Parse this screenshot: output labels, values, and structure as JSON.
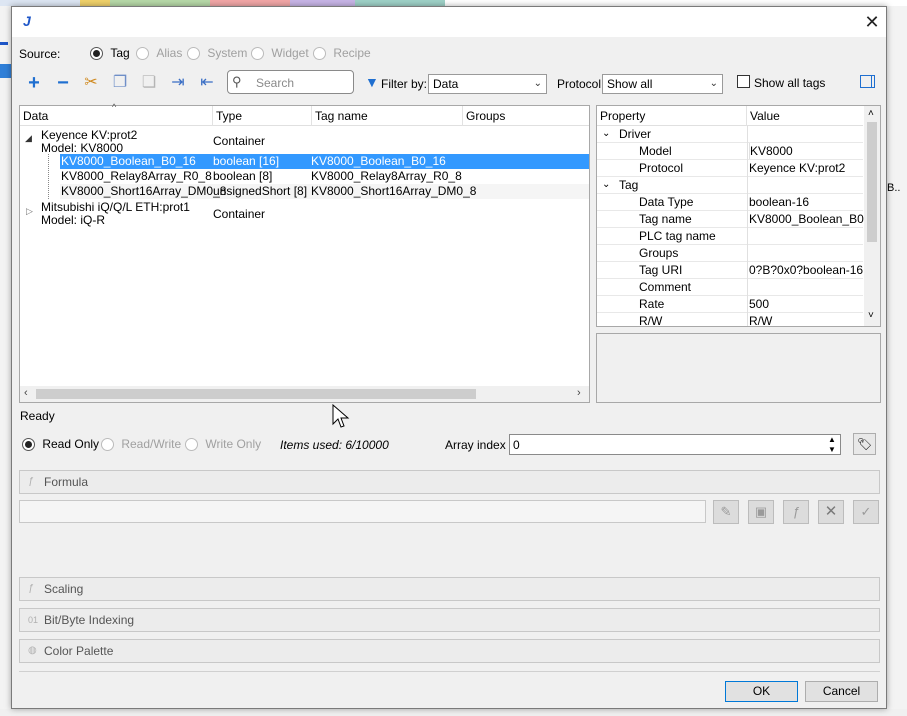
{
  "dialog": {
    "app_icon": "J",
    "close_glyph": "✕",
    "source": {
      "label": "Source:",
      "options": [
        "Tag",
        "Alias",
        "System",
        "Widget",
        "Recipe"
      ],
      "selected": "Tag"
    },
    "toolbar": {
      "search_placeholder": "Search",
      "filter_label": "Filter by:",
      "filter_value": "Data",
      "protocol_label": "Protocol:",
      "protocol_value": "Show all",
      "show_all_tags": "Show all tags"
    },
    "tree": {
      "columns": [
        "Data",
        "Type",
        "Tag name",
        "Groups"
      ],
      "groups": [
        {
          "line1": "Keyence KV:prot2",
          "line2": "Model: KV8000",
          "type": "Container",
          "expanded": true,
          "children": [
            {
              "data": "KV8000_Boolean_B0_16",
              "type": "boolean [16]",
              "tag": "KV8000_Boolean_B0_16",
              "selected": true
            },
            {
              "data": "KV8000_Relay8Array_R0_8",
              "type": "boolean [8]",
              "tag": "KV8000_Relay8Array_R0_8",
              "selected": false
            },
            {
              "data": "KV8000_Short16Array_DM0_8",
              "type": "unsignedShort [8]",
              "tag": "KV8000_Short16Array_DM0_8",
              "selected": false
            }
          ]
        },
        {
          "line1": "Mitsubishi iQ/Q/L ETH:prot1",
          "line2": "Model: iQ-R",
          "type": "Container",
          "expanded": false,
          "children": []
        }
      ]
    },
    "properties": {
      "columns": [
        "Property",
        "Value"
      ],
      "driver_section": "Driver",
      "driver_rows": [
        {
          "property": "Model",
          "value": "KV8000"
        },
        {
          "property": "Protocol",
          "value": "Keyence KV:prot2"
        }
      ],
      "tag_section": "Tag",
      "tag_rows": [
        {
          "property": "Data Type",
          "value": "boolean-16"
        },
        {
          "property": "Tag name",
          "value": "KV8000_Boolean_B0..."
        },
        {
          "property": "PLC tag name",
          "value": ""
        },
        {
          "property": "Groups",
          "value": ""
        },
        {
          "property": "Tag URI",
          "value": "0?B?0x0?boolean-16"
        },
        {
          "property": "Comment",
          "value": ""
        },
        {
          "property": "Rate",
          "value": "500"
        },
        {
          "property": "R/W",
          "value": "R/W"
        }
      ]
    },
    "status": "Ready",
    "access": {
      "options": [
        "Read Only",
        "Read/Write",
        "Write Only"
      ],
      "selected": "Read Only"
    },
    "items_used": "Items used:  6/10000",
    "array_index_label": "Array index",
    "array_index_value": "0",
    "sections": [
      "Formula",
      "Scaling",
      "Bit/Byte Indexing",
      "Color Palette"
    ],
    "ok": "OK",
    "cancel": "Cancel"
  },
  "background": {
    "right_fragment": "B.."
  }
}
